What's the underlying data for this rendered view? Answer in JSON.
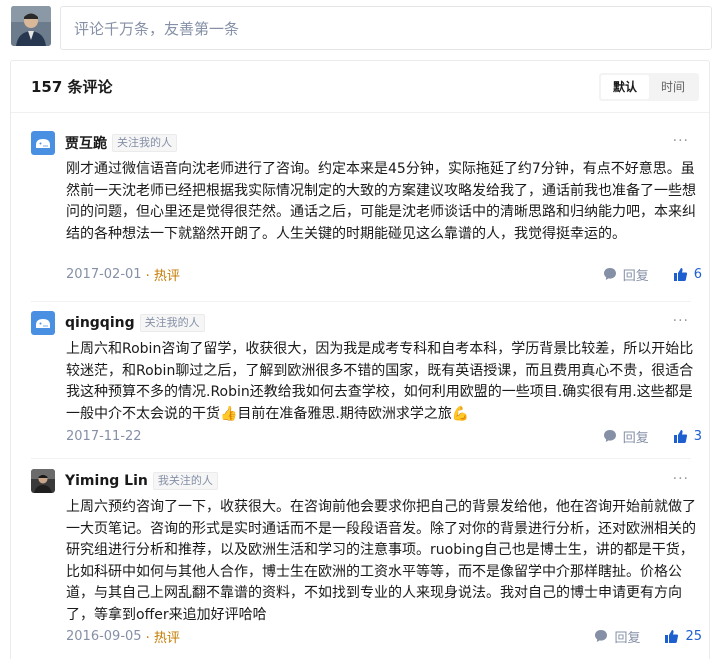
{
  "composer": {
    "placeholder": "评论千万条，友善第一条"
  },
  "header": {
    "count_label": "157 条评论",
    "sort_default": "默认",
    "sort_time": "时间"
  },
  "comments": [
    {
      "name": "贾互跪",
      "tag": "关注我的人",
      "text": "刚才通过微信语音向沈老师进行了咨询。约定本来是45分钟，实际拖延了约7分钟，有点不好意思。虽然前一天沈老师已经把根据我实际情况制定的大致的方案建议攻略发给我了，通话前我也准备了一些想问的问题，但心里还是觉得很茫然。通话之后，可能是沈老师谈话中的清晰思路和归纳能力吧，本来纠结的各种想法一下就豁然开朗了。人生关键的时期能碰见这么靠谱的人，我觉得挺幸运的。",
      "date": "2017-02-01",
      "hot": "· 热评",
      "reply": "回复",
      "likes": "6"
    },
    {
      "name": "qingqing",
      "tag": "关注我的人",
      "text": "上周六和Robin咨询了留学，收获很大，因为我是成考专科和自考本科，学历背景比较差，所以开始比较迷茫，和Robin聊过之后，了解到欧洲很多不错的国家，既有英语授课，而且费用真心不贵，很适合我这种预算不多的情况.Robin还教给我如何去查学校，如何利用欧盟的一些项目.确实很有用.这些都是一般中介不太会说的干货👍目前在准备雅思.期待欧洲求学之旅💪",
      "date": "2017-11-22",
      "hot": "",
      "reply": "回复",
      "likes": "3"
    },
    {
      "name": "Yiming Lin",
      "tag": "我关注的人",
      "text": "上周六预约咨询了一下，收获很大。在咨询前他会要求你把自己的背景发给他，他在咨询开始前就做了一大页笔记。咨询的形式是实时通话而不是一段段语音发。除了对你的背景进行分析，还对欧洲相关的研究组进行分析和推荐，以及欧洲生活和学习的注意事项。ruobing自己也是博士生，讲的都是干货，比如科研中如何与其他人合作，博士生在欧洲的工资水平等等，而不是像留学中介那样瞎扯。价格公道，与其自己上网乱翻不靠谱的资料，不如找到专业的人来现身说法。我对自己的博士申请更有方向了，等拿到offer来追加好评哈哈",
      "date": "2016-09-05",
      "hot": "· 热评",
      "reply": "回复",
      "likes": "25"
    }
  ],
  "colors": {
    "accent": "#1e5fd0",
    "muted": "#8590a6",
    "hot": "#c47a00",
    "avatar_blue": "#4a90e2"
  },
  "icons": {
    "reply": "speech-bubble-icon",
    "like": "thumbs-up-icon",
    "more": "more-dots-icon"
  }
}
